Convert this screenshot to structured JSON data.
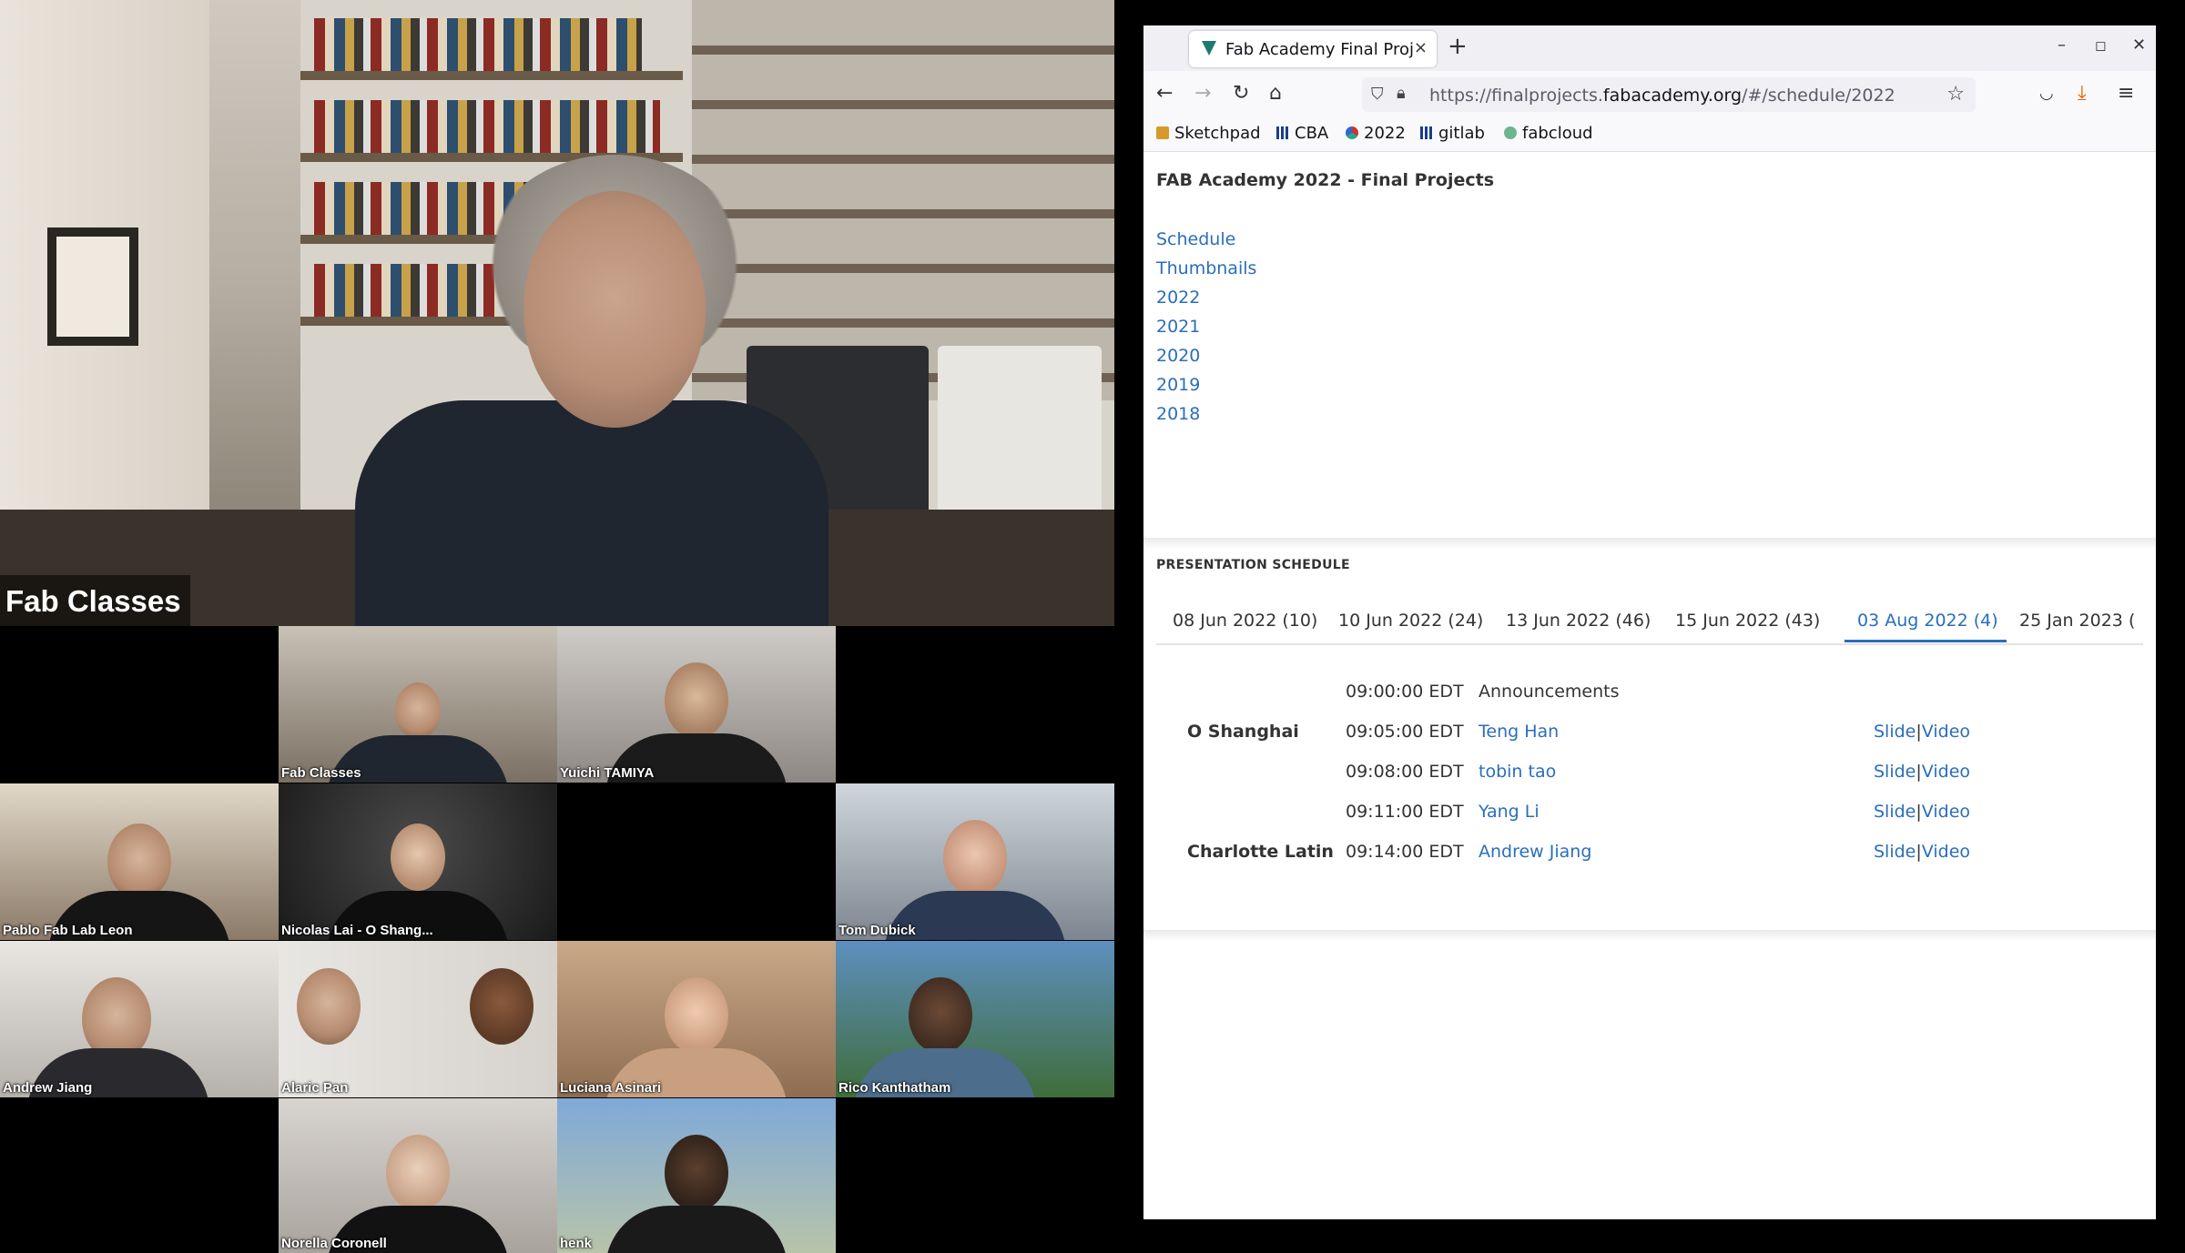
{
  "conference": {
    "speaker_name": "Fab Classes",
    "participants": [
      {
        "name": "Fab Classes"
      },
      {
        "name": "Yuichi TAMIYA"
      },
      {
        "name": "Pablo Fab Lab Leon"
      },
      {
        "name": "Nicolas Lai - O Shang..."
      },
      {
        "name": "Tom Dubick"
      },
      {
        "name": "Andrew Jiang"
      },
      {
        "name": "Alaric Pan"
      },
      {
        "name": "Luciana Asinari"
      },
      {
        "name": "Rico Kanthatham"
      },
      {
        "name": "Norella Coronell"
      },
      {
        "name": "henk"
      }
    ]
  },
  "browser": {
    "tab_title": "Fab Academy Final Proj",
    "tab_close": "×",
    "new_tab": "+",
    "url_prefix": "https://finalprojects.",
    "url_domain": "fabacademy.org",
    "url_suffix": "/#/schedule/2022",
    "bookmarks": [
      "Sketchpad",
      "CBA",
      "2022",
      "gitlab",
      "fabcloud"
    ]
  },
  "page": {
    "title": "FAB Academy 2022 - Final Projects",
    "nav": [
      "Schedule",
      "Thumbnails",
      "2022",
      "2021",
      "2020",
      "2019",
      "2018"
    ],
    "schedule_heading": "PRESENTATION SCHEDULE",
    "date_tabs": [
      "08 Jun 2022 (10)",
      "10 Jun 2022 (24)",
      "13 Jun 2022 (46)",
      "15 Jun 2022 (43)",
      "03 Aug 2022 (4)",
      "25 Jan 2023 ("
    ],
    "active_tab_index": 4,
    "rows": [
      {
        "site": "",
        "time": "09:00:00 EDT",
        "who": "Announcements",
        "slide": "",
        "video": ""
      },
      {
        "site": "O Shanghai",
        "time": "09:05:00 EDT",
        "who": "Teng Han",
        "slide": "Slide",
        "video": "Video"
      },
      {
        "site": "",
        "time": "09:08:00 EDT",
        "who": "tobin tao",
        "slide": "Slide",
        "video": "Video"
      },
      {
        "site": "",
        "time": "09:11:00 EDT",
        "who": "Yang Li",
        "slide": "Slide",
        "video": "Video"
      },
      {
        "site": "Charlotte Latin",
        "time": "09:14:00 EDT",
        "who": "Andrew Jiang",
        "slide": "Slide",
        "video": "Video"
      }
    ],
    "link_separator": "|"
  }
}
